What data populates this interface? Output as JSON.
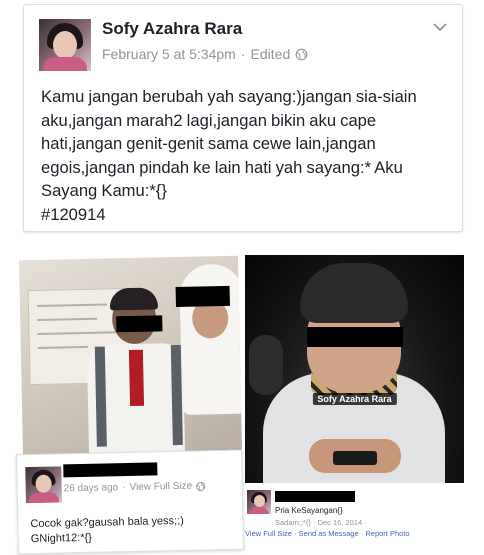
{
  "post": {
    "author": "Sofy Azahra Rara",
    "timestamp": "February 5 at 5:34pm",
    "separator": " · ",
    "edited": "Edited",
    "privacy_icon": "globe-icon",
    "menu_icon": "chevron-down-icon",
    "text": "Kamu jangan berubah yah sayang:)jangan sia-siain aku,jangan marah2 lagi,jangan bikin aku cape hati,jangan genit-genit sama cewe lain,jangan egois,jangan pindah ke lain hati yah sayang:* Aku Sayang Kamu:*{}",
    "hashtag": "#120914"
  },
  "photo_right": {
    "watermark": "Sofy Azahra Rara"
  },
  "comment_left": {
    "time": "26 days ago",
    "separator": " · ",
    "view_link": "View Full Size",
    "privacy_icon": "globe-icon",
    "text": "Cocok gak?gausah bala yess;;)",
    "text2": "GNight12:*{}"
  },
  "comment_right": {
    "name": "Pria KeSayangan{}",
    "meta": "Sadam;;*{} · Dec 16, 2014 · ",
    "view_link": "View Full Size",
    "send_link": "Send as Message",
    "report_link": "Report Photo",
    "separator": " · "
  },
  "colors": {
    "text": "#1d2129",
    "meta": "#90949c",
    "link": "#4267b2",
    "card_border": "#dddfe2"
  }
}
